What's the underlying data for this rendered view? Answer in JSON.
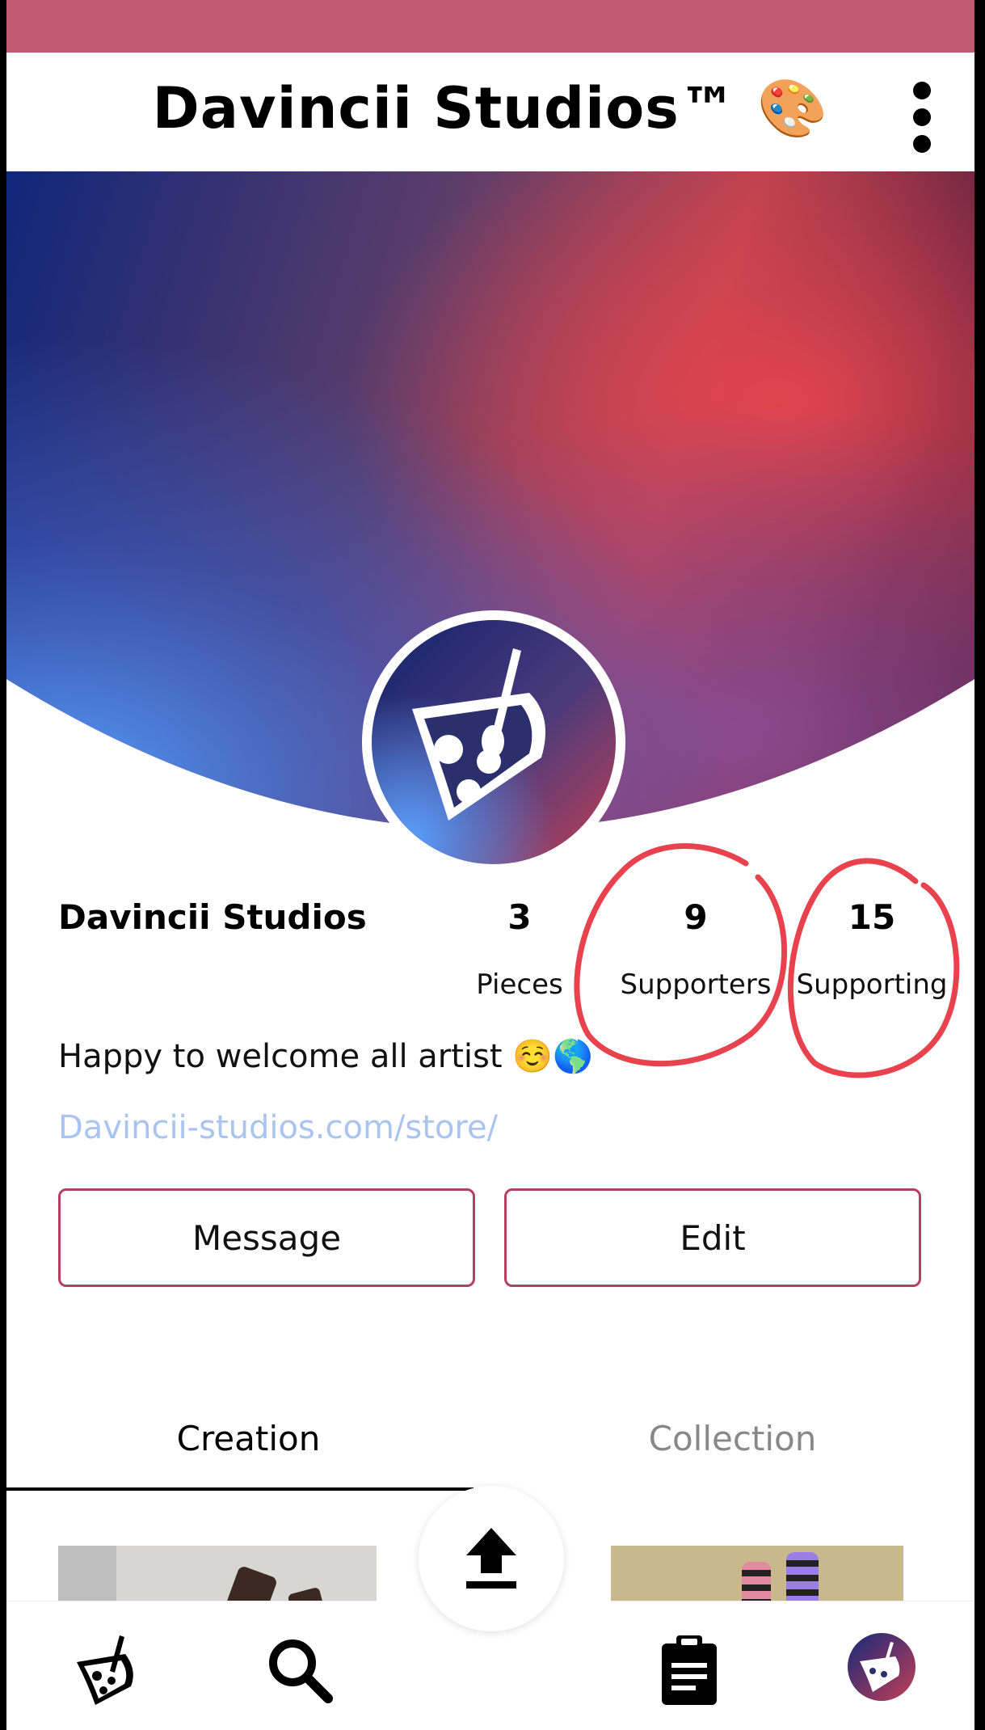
{
  "header": {
    "title": "Davincii Studios™ 🎨",
    "menu_icon": "kebab-menu-icon"
  },
  "profile": {
    "name": "Davincii Studios",
    "stats": [
      {
        "value": "3",
        "label": "Pieces"
      },
      {
        "value": "9",
        "label": "Supporters"
      },
      {
        "value": "15",
        "label": "Supporting"
      }
    ],
    "bio": "Happy to welcome all artist ☺️🌎",
    "link": "Davincii-studios.com/store/"
  },
  "actions": {
    "message_label": "Message",
    "edit_label": "Edit"
  },
  "tabs": [
    {
      "label": "Creation",
      "active": true
    },
    {
      "label": "Collection",
      "active": false
    }
  ],
  "bottom_nav": {
    "items": [
      "home-palette-icon",
      "search-icon",
      "upload-icon",
      "clipboard-icon",
      "profile-avatar-icon"
    ]
  },
  "colors": {
    "status_strip": "#c05a6e",
    "button_border": "#b04160",
    "link": "#a9c4ee",
    "annotation": "#e8424e"
  }
}
